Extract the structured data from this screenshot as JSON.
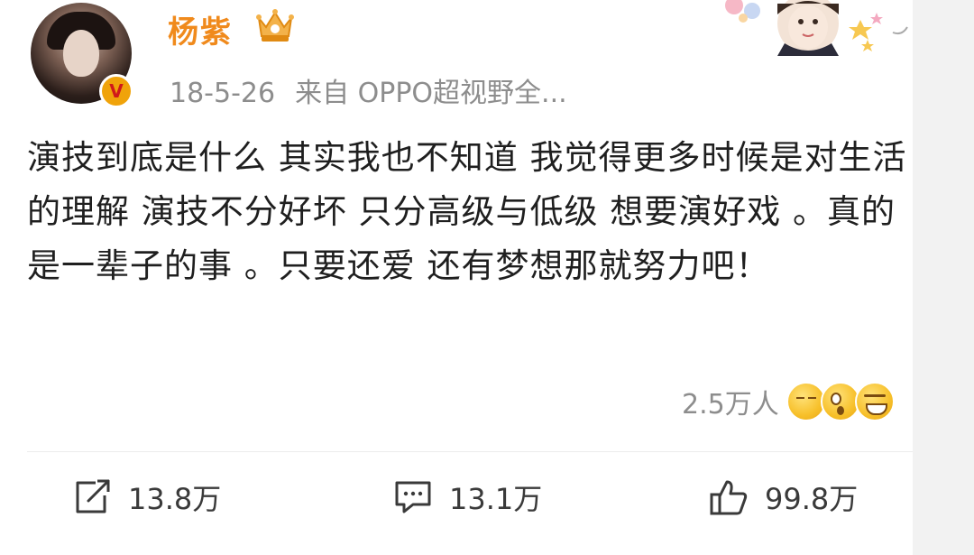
{
  "post": {
    "author": "杨紫",
    "date": "18-5-26",
    "source": "来自 OPPO超视野全...",
    "verified_mark": "V",
    "text": "演技到底是什么 其实我也不知道 我觉得更多时候是对生活的理解 演技不分好坏 只分高级与低级 想要演好戏 。真的是一辈子的事 。只要还爱 还有梦想那就努力吧！",
    "reactions_count": "2.5万人",
    "reaction_emojis": [
      "speechless-emoji",
      "shocked-emoji",
      "laughing-emoji"
    ]
  },
  "actions": {
    "repost_count": "13.8万",
    "comment_count": "13.1万",
    "like_count": "99.8万"
  },
  "colors": {
    "username": "#f08a1c",
    "meta_text": "#8d8d8d",
    "body_text": "#1f1f1f",
    "verified_badge": "#f0a30a"
  }
}
